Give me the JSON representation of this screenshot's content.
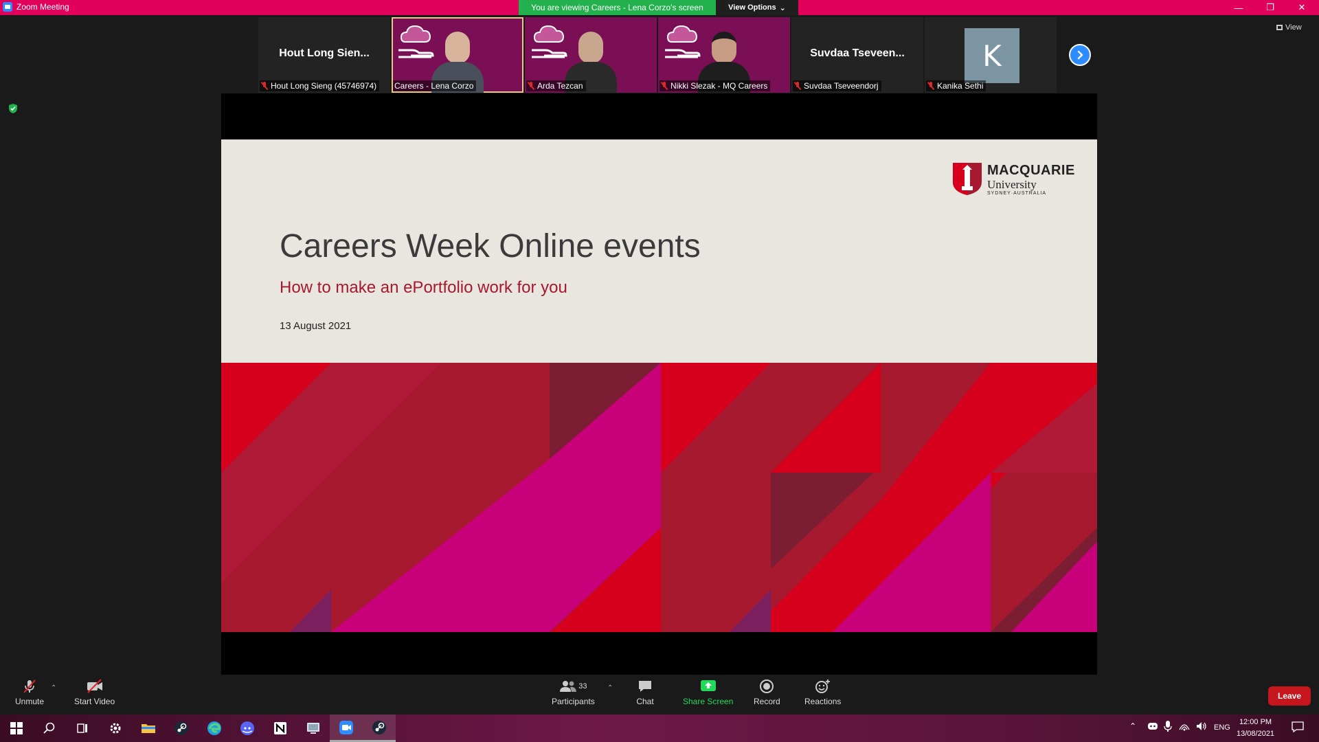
{
  "window": {
    "title": "Zoom Meeting",
    "viewing_banner": "You are viewing Careers - Lena Corzo's screen",
    "view_options": "View Options"
  },
  "participants_strip": [
    {
      "name": "Hout Long Sieng (45746974)",
      "display": "Hout Long Sien...",
      "video": false
    },
    {
      "name": "Careers - Lena Corzo",
      "video": true,
      "active": true
    },
    {
      "name": "Arda Tezcan",
      "video": true
    },
    {
      "name": "Nikki Slezak - MQ Careers",
      "video": true
    },
    {
      "name": "Suvdaa Tseveendorj",
      "display": "Suvdaa Tseveen...",
      "video": false
    },
    {
      "name": "Kanika Sethi",
      "avatar_letter": "K",
      "video": false
    }
  ],
  "view_button": "View",
  "slide": {
    "title": "Careers Week Online events",
    "subtitle": "How to make an ePortfolio work for you",
    "date": "13 August 2021",
    "logo_wordmark": "MACQUARIE",
    "logo_university": "University",
    "logo_tagline": "SYDNEY·AUSTRALIA"
  },
  "toolbar": {
    "unmute": "Unmute",
    "start_video": "Start Video",
    "participants": "Participants",
    "participant_count": "33",
    "chat": "Chat",
    "share_screen": "Share Screen",
    "record": "Record",
    "reactions": "Reactions",
    "leave": "Leave"
  },
  "taskbar": {
    "language": "ENG",
    "time": "12:00 PM",
    "date": "13/08/2021",
    "apps": [
      "windows-start",
      "search",
      "task-view",
      "settings",
      "file-explorer",
      "steam",
      "edge",
      "discord",
      "notion",
      "remote-desktop",
      "zoom",
      "steam"
    ]
  },
  "colors": {
    "titlebar": "#e1005a",
    "banner_green": "#23b14d",
    "leave_red": "#c4161c",
    "share_green": "#23d959",
    "mq_red": "#a6192e"
  }
}
